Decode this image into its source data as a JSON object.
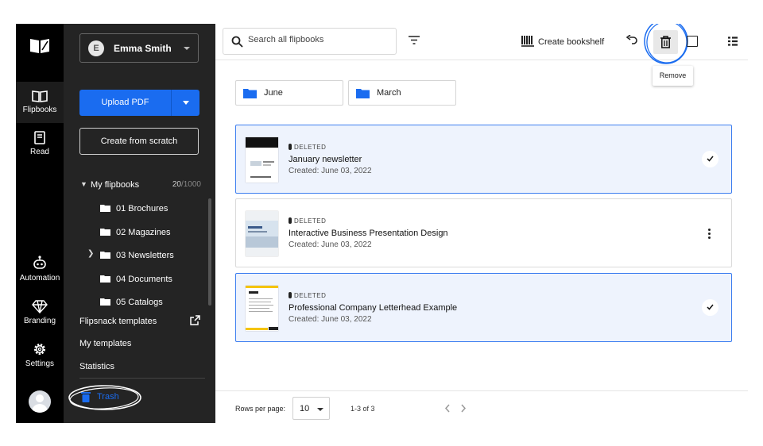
{
  "rail": {
    "items": [
      {
        "label": "Flipbooks",
        "icon": "book-open-icon"
      },
      {
        "label": "Read",
        "icon": "reader-icon"
      },
      {
        "label": "Automation",
        "icon": "robot-icon"
      },
      {
        "label": "Branding",
        "icon": "diamond-icon"
      },
      {
        "label": "Settings",
        "icon": "gear-icon"
      }
    ]
  },
  "sidebar": {
    "user_initial": "E",
    "user_name": "Emma Smith",
    "upload_label": "Upload PDF",
    "scratch_label": "Create from scratch",
    "my_flipbooks": {
      "label": "My flipbooks",
      "count": "20",
      "max": "/1000"
    },
    "folders": [
      "01 Brochures",
      "02 Magazines",
      "03 Newsletters",
      "04 Documents",
      "05 Catalogs"
    ],
    "links": [
      "Flipsnack templates",
      "My templates",
      "Statistics"
    ],
    "trash_label": "Trash"
  },
  "toolbar": {
    "search_placeholder": "Search all flipbooks",
    "bookshelf_label": "Create bookshelf",
    "tooltip": "Remove"
  },
  "folder_cards": [
    "June",
    "March"
  ],
  "items": [
    {
      "status": "DELETED",
      "title": "January newsletter",
      "created": "Created: June 03, 2022",
      "selected": true
    },
    {
      "status": "DELETED",
      "title": "Interactive Business Presentation Design",
      "created": "Created: June 03, 2022",
      "selected": false
    },
    {
      "status": "DELETED",
      "title": "Professional Company Letterhead Example",
      "created": "Created: June 03, 2022",
      "selected": true
    }
  ],
  "pagination": {
    "rows_label": "Rows per page:",
    "rows_value": "10",
    "range": "1-3 of 3"
  },
  "colors": {
    "accent": "#1a6cf0",
    "sidebar": "#242424",
    "rail": "#000000",
    "selected_bg": "#eef3fd"
  }
}
